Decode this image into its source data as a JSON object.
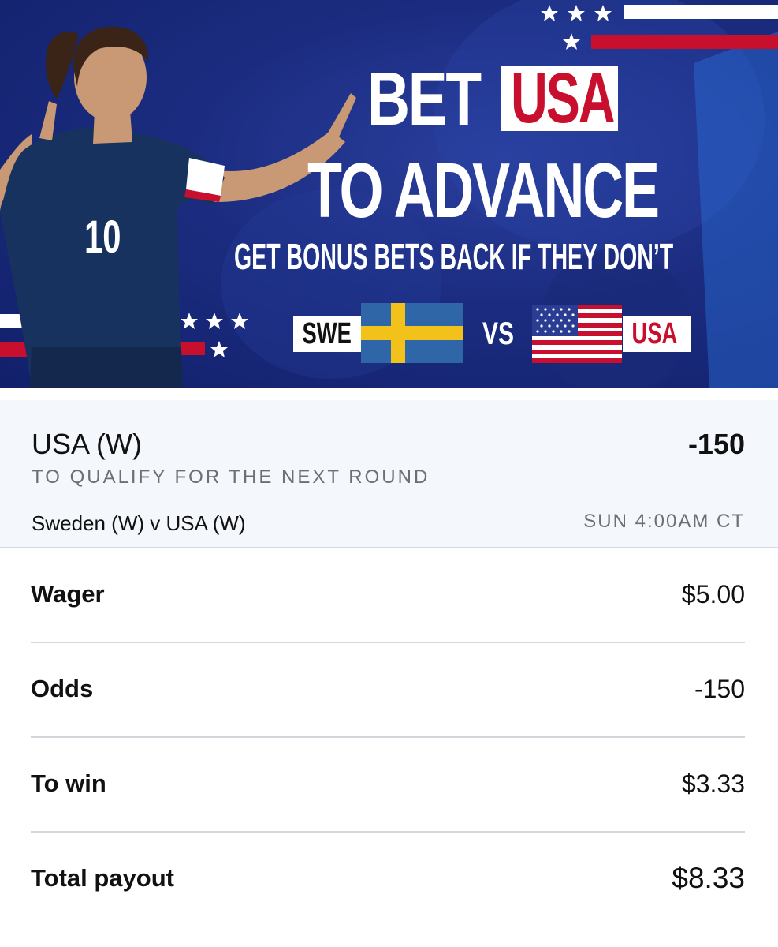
{
  "banner": {
    "headline_word": "BET",
    "headline_team": "USA",
    "headline_line2": "TO ADVANCE",
    "subheadline": "GET BONUS BETS BACK IF THEY DON’T",
    "team_left": "SWE",
    "versus": "VS",
    "team_right": "USA",
    "player_number": "10",
    "colors": {
      "background": "#1b2c80",
      "red": "#c8102e",
      "swe_blue": "#2f66a8",
      "swe_yellow": "#f2c21b"
    }
  },
  "selection": {
    "name": "USA (W)",
    "odds": "-150",
    "market": "TO QUALIFY FOR THE NEXT ROUND",
    "event": "Sweden (W) v USA (W)",
    "start_time": "SUN 4:00AM CT"
  },
  "details": {
    "wager": {
      "label": "Wager",
      "value": "$5.00"
    },
    "odds": {
      "label": "Odds",
      "value": "-150"
    },
    "to_win": {
      "label": "To win",
      "value": "$3.33"
    },
    "total_payout": {
      "label": "Total payout",
      "value": "$8.33"
    }
  }
}
